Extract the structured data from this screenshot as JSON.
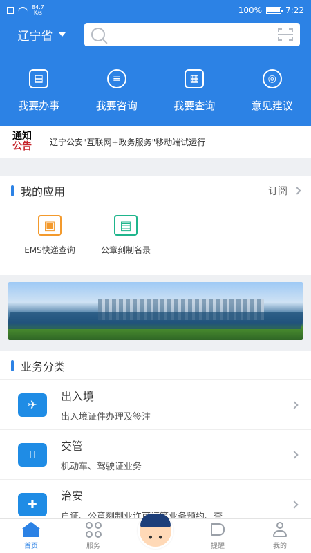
{
  "status": {
    "network_speed": "84.7\nK/s",
    "battery_percent": "100%",
    "time": "7:22"
  },
  "header": {
    "province": "辽宁省",
    "search": {
      "placeholder": ""
    }
  },
  "quick_actions": [
    {
      "label": "我要办事",
      "icon": "document-icon"
    },
    {
      "label": "我要咨询",
      "icon": "chat-icon"
    },
    {
      "label": "我要查询",
      "icon": "query-icon"
    },
    {
      "label": "意见建议",
      "icon": "person-icon"
    }
  ],
  "notice": {
    "logo_top": "通知",
    "logo_bottom": "公告",
    "text": "辽宁公安\"互联网+政务服务\"移动端试运行"
  },
  "my_apps": {
    "title": "我的应用",
    "subscribe_label": "订阅",
    "items": [
      {
        "label": "EMS快递查询",
        "icon": "truck-icon",
        "color": "#f39a2d"
      },
      {
        "label": "公章刻制名录",
        "icon": "card-icon",
        "color": "#1fb58c"
      }
    ]
  },
  "business": {
    "title": "业务分类",
    "items": [
      {
        "title": "出入境",
        "desc": "出入境证件办理及签注",
        "icon": "plane-icon"
      },
      {
        "title": "交管",
        "desc": "机动车、驾驶证业务",
        "icon": "traffic-icon"
      },
      {
        "title": "治安",
        "desc": "户证、公章刻制业许可证等业务预约、查",
        "icon": "shield-icon"
      }
    ]
  },
  "tabbar": [
    {
      "label": "首页",
      "icon": "home-icon",
      "active": true
    },
    {
      "label": "服务",
      "icon": "services-icon",
      "active": false
    },
    {
      "label": "提醒",
      "icon": "megaphone-icon",
      "active": false
    },
    {
      "label": "我的",
      "icon": "profile-icon",
      "active": false
    }
  ],
  "colors": {
    "primary": "#2c82e5",
    "notice_red": "#c6242b"
  }
}
